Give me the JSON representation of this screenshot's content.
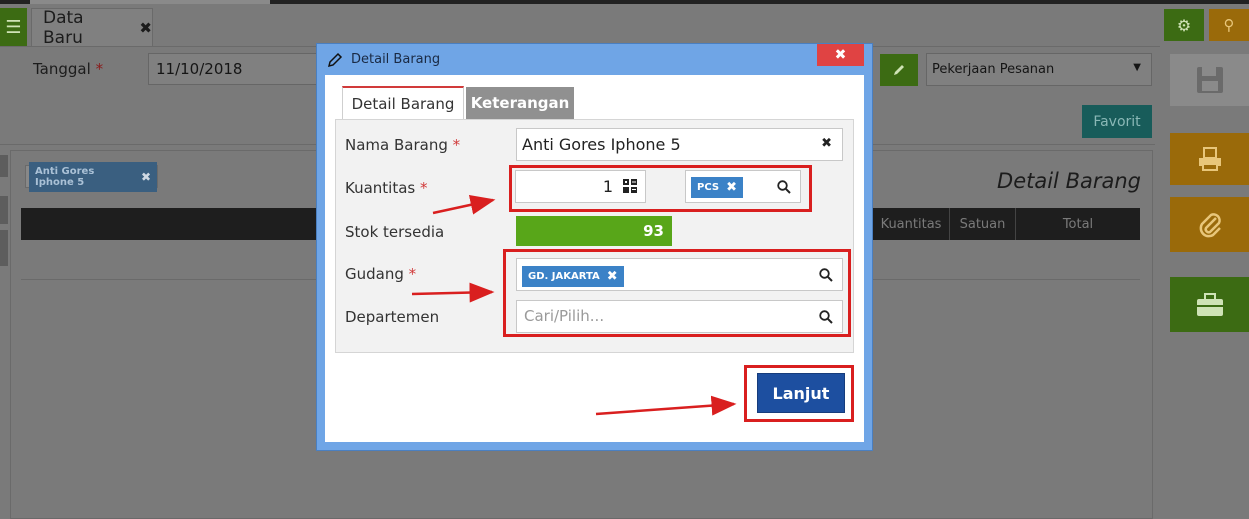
{
  "app": {
    "tab_title": "Data Baru",
    "tab_close_glyph": "✖",
    "menu_glyph": "☰",
    "gear_glyph": "⚙",
    "pin_glyph": "⚲"
  },
  "form": {
    "tanggal_label": "Tanggal",
    "required_mark": "*",
    "tanggal_value": "11/10/2018",
    "pekerjaan_value": "Pekerjaan Pesanan",
    "favorit_label": "Favorit",
    "item_chip": "Anti Gores Iphone 5",
    "chip_remove_glyph": "✖",
    "section_title": "Detail Barang"
  },
  "table": {
    "columns": [
      "Kuantitas",
      "Satuan",
      "Total"
    ]
  },
  "modal": {
    "title": "Detail Barang",
    "close_glyph": "✖",
    "tabs": [
      "Detail Barang",
      "Keterangan"
    ],
    "fields": {
      "nama_barang_label": "Nama Barang",
      "nama_barang_value": "Anti Gores Iphone 5",
      "clear_glyph": "✖",
      "kuantitas_label": "Kuantitas",
      "kuantitas_value": "1",
      "satuan_tag": "PCS",
      "stok_label": "Stok tersedia",
      "stok_value": "93",
      "gudang_label": "Gudang",
      "gudang_tag": "GD. JAKARTA",
      "departemen_label": "Departemen",
      "departemen_placeholder": "Cari/Pilih..."
    },
    "submit_label": "Lanjut"
  },
  "colors": {
    "modal_frame": "#6fa5e6",
    "tag_blue": "#3b82c7",
    "stok_green": "#58a619",
    "primary_button": "#1d4fa0",
    "annotation_red": "#d91f1f",
    "close_red": "#e04343"
  },
  "icons": {
    "edit": "pencil-icon",
    "search": "search-icon",
    "calculator": "calculator-icon",
    "remove": "close-icon",
    "save": "save-icon",
    "print": "print-icon",
    "attach": "paperclip-icon",
    "briefcase": "briefcase-icon"
  }
}
